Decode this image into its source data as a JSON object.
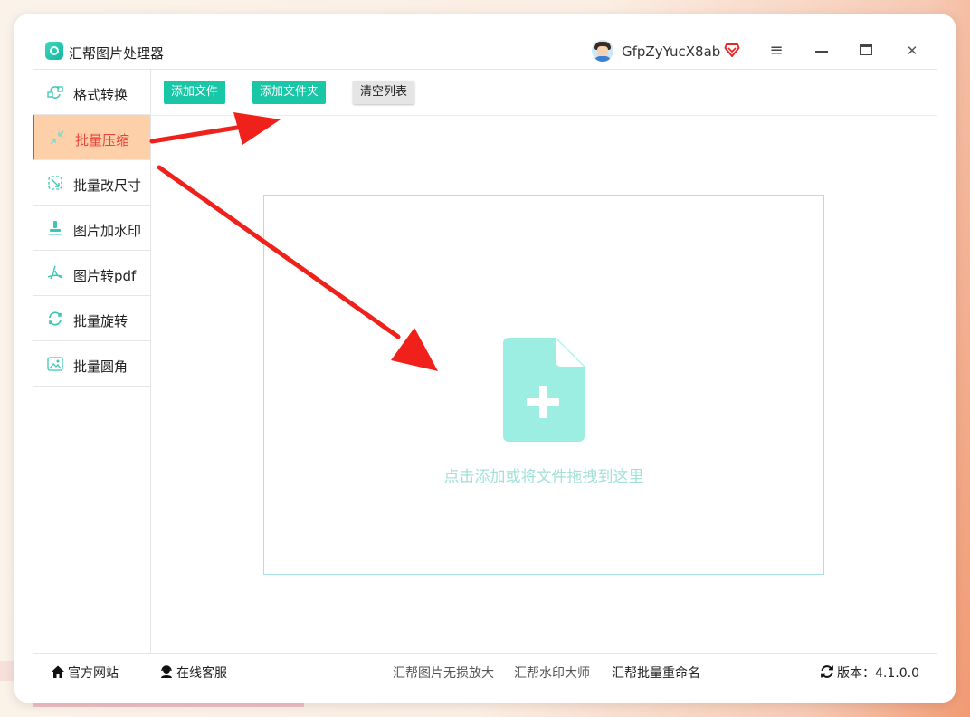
{
  "app": {
    "title": "汇帮图片处理器",
    "username": "GfpZyYucX8ab"
  },
  "window_controls": {
    "menu": "≡",
    "close": "✕"
  },
  "sidebar": {
    "items": [
      {
        "label": "格式转换",
        "icon": "format-convert-icon"
      },
      {
        "label": "批量压缩",
        "icon": "compress-icon",
        "active": true
      },
      {
        "label": "批量改尺寸",
        "icon": "resize-icon"
      },
      {
        "label": "图片加水印",
        "icon": "watermark-icon"
      },
      {
        "label": "图片转pdf",
        "icon": "pdf-icon"
      },
      {
        "label": "批量旋转",
        "icon": "rotate-icon"
      },
      {
        "label": "批量圆角",
        "icon": "round-corner-icon"
      }
    ]
  },
  "toolbar": {
    "add_file": "添加文件",
    "add_folder": "添加文件夹",
    "clear_list": "清空列表"
  },
  "dropzone": {
    "hint": "点击添加或将文件拖拽到这里"
  },
  "footer": {
    "website": "官方网站",
    "support": "在线客服",
    "link1": "汇帮图片无损放大",
    "link2": "汇帮水印大师",
    "link3": "汇帮批量重命名",
    "version_label": "版本：",
    "version": "4.1.0.0"
  },
  "colors": {
    "accent": "#19c6a6",
    "active_bg": "#fdd0a9",
    "active_text": "#e8453a",
    "annotation_arrow": "#f0201a"
  }
}
